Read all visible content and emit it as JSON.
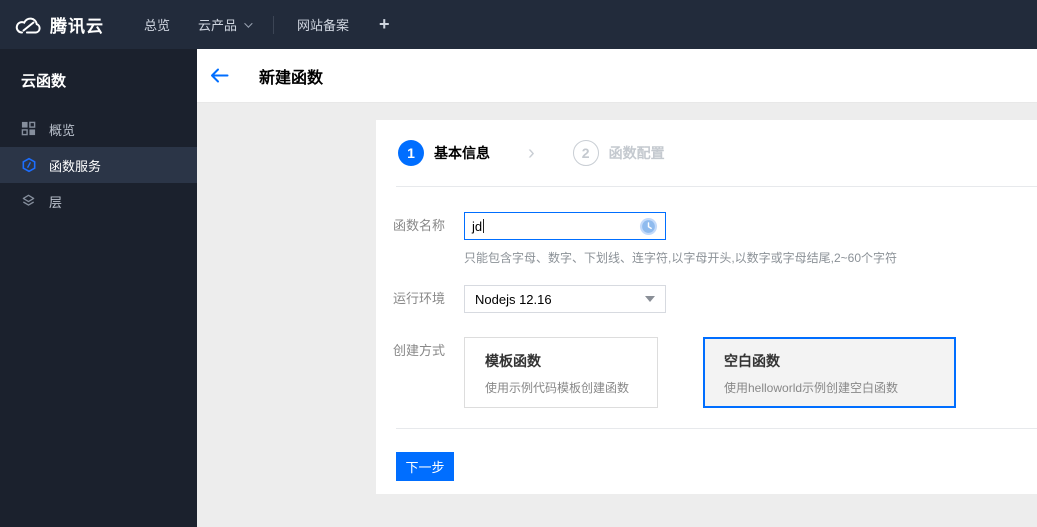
{
  "colors": {
    "accent": "#006eff",
    "topnav_bg": "#222b3b",
    "sidebar_bg": "#1b212d",
    "sidebar_active_bg": "#2b3547"
  },
  "topnav": {
    "brand": "腾讯云",
    "items": [
      {
        "label": "总览"
      },
      {
        "label": "云产品"
      },
      {
        "label": "网站备案"
      }
    ],
    "plus": "+"
  },
  "sidebar": {
    "title": "云函数",
    "items": [
      {
        "label": "概览",
        "icon": "grid-icon",
        "active": false
      },
      {
        "label": "函数服务",
        "icon": "scf-hexagon-icon",
        "active": true
      },
      {
        "label": "层",
        "icon": "layers-icon",
        "active": false
      }
    ]
  },
  "header": {
    "title": "新建函数"
  },
  "steps": {
    "separator": "›",
    "list": [
      {
        "num": "1",
        "label": "基本信息",
        "active": true
      },
      {
        "num": "2",
        "label": "函数配置",
        "active": false
      }
    ]
  },
  "form": {
    "name_label": "函数名称",
    "name_value": "jd",
    "name_help": "只能包含字母、数字、下划线、连字符,以字母开头,以数字或字母结尾,2~60个字符",
    "runtime_label": "运行环境",
    "runtime_value": "Nodejs 12.16",
    "method_label": "创建方式",
    "methods": [
      {
        "title": "模板函数",
        "desc": "使用示例代码模板创建函数",
        "selected": false
      },
      {
        "title": "空白函数",
        "desc": "使用helloworld示例创建空白函数",
        "selected": true
      }
    ]
  },
  "footer": {
    "next_label": "下一步"
  }
}
